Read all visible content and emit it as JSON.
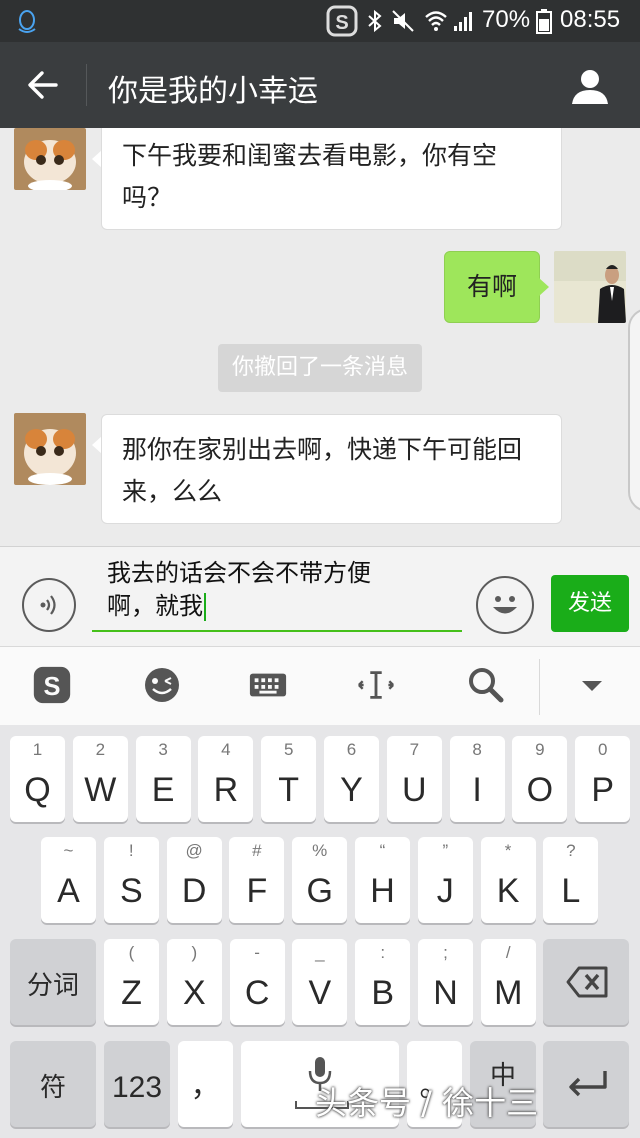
{
  "status_bar": {
    "battery": "70%",
    "time": "08:55"
  },
  "header": {
    "title": "你是我的小幸运"
  },
  "chat": {
    "messages": [
      {
        "side": "left",
        "lines": [
          "下午我要和闺蜜去看电影，你有空",
          "吗？"
        ]
      },
      {
        "side": "right",
        "lines": [
          "有啊"
        ]
      },
      {
        "side": "system",
        "text": "你撤回了一条消息"
      },
      {
        "side": "left",
        "lines": [
          "那你在家别出去啊，快递下午可能回",
          "来，么么"
        ]
      }
    ]
  },
  "composer": {
    "text_line1": "我去的话会不会不带方便",
    "text_line2": "啊，就我",
    "send_label": "发送"
  },
  "keyboard": {
    "row1": [
      {
        "main": "Q",
        "sub": "1"
      },
      {
        "main": "W",
        "sub": "2"
      },
      {
        "main": "E",
        "sub": "3"
      },
      {
        "main": "R",
        "sub": "4"
      },
      {
        "main": "T",
        "sub": "5"
      },
      {
        "main": "Y",
        "sub": "6"
      },
      {
        "main": "U",
        "sub": "7"
      },
      {
        "main": "I",
        "sub": "8"
      },
      {
        "main": "O",
        "sub": "9"
      },
      {
        "main": "P",
        "sub": "0"
      }
    ],
    "row2": [
      {
        "main": "A",
        "sub": "~"
      },
      {
        "main": "S",
        "sub": "!"
      },
      {
        "main": "D",
        "sub": "@"
      },
      {
        "main": "F",
        "sub": "#"
      },
      {
        "main": "G",
        "sub": "%"
      },
      {
        "main": "H",
        "sub": "“"
      },
      {
        "main": "J",
        "sub": "”"
      },
      {
        "main": "K",
        "sub": "*"
      },
      {
        "main": "L",
        "sub": "?"
      }
    ],
    "row3": [
      {
        "main": "Z",
        "sub": "("
      },
      {
        "main": "X",
        "sub": ")"
      },
      {
        "main": "C",
        "sub": "-"
      },
      {
        "main": "V",
        "sub": "_"
      },
      {
        "main": "B",
        "sub": ":"
      },
      {
        "main": "N",
        "sub": ";"
      },
      {
        "main": "M",
        "sub": "/"
      }
    ],
    "fenci_label": "分词",
    "symbol_label": "符",
    "numbers_label": "123",
    "comma_label": "，",
    "lang_label": "中"
  },
  "watermark": "头条号 / 徐十三",
  "colors": {
    "send": "#1aad19",
    "bubble_right": "#9ee65b",
    "header": "#3a3d3f"
  }
}
